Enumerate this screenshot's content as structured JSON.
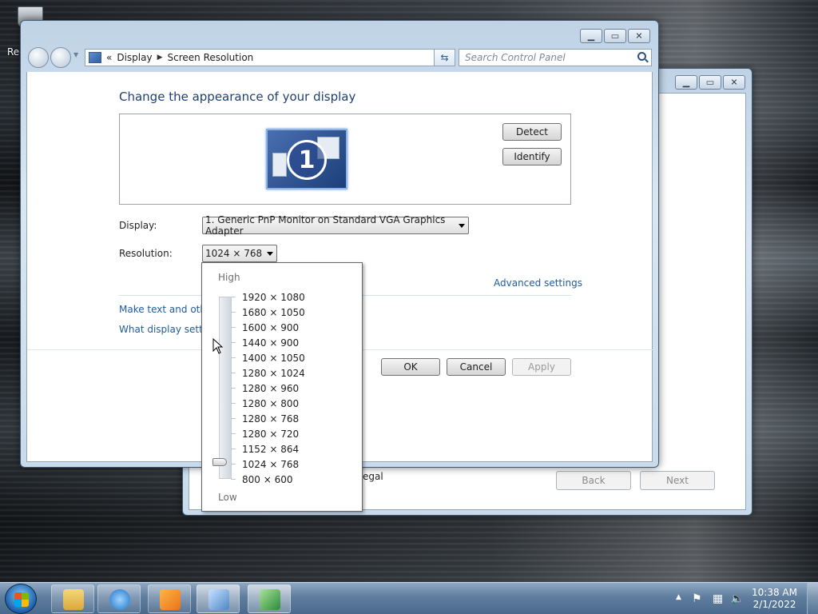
{
  "desktop": {
    "recycle_label": "Rec"
  },
  "back_window": {
    "partial_text": "egal",
    "back_label": "Back",
    "next_label": "Next"
  },
  "main_window": {
    "breadcrumb": {
      "chevrons": "«",
      "item1": "Display",
      "item2": "Screen Resolution"
    },
    "search_placeholder": "Search Control Panel",
    "heading": "Change the appearance of your display",
    "detect_label": "Detect",
    "identify_label": "Identify",
    "monitor_number": "1",
    "display_label": "Display:",
    "display_value": "1. Generic PnP Monitor on Standard VGA Graphics Adapter",
    "resolution_label": "Resolution:",
    "resolution_value": "1024 × 768",
    "advanced_link": "Advanced settings",
    "link1": "Make text and other",
    "link2": "What display setting",
    "ok_label": "OK",
    "cancel_label": "Cancel",
    "apply_label": "Apply"
  },
  "resolution_popup": {
    "high_label": "High",
    "low_label": "Low",
    "options": [
      "1920 × 1080",
      "1680 × 1050",
      "1600 × 900",
      "1440 × 900",
      "1400 × 1050",
      "1280 × 1024",
      "1280 × 960",
      "1280 × 800",
      "1280 × 768",
      "1280 × 720",
      "1152 × 864",
      "1024 × 768",
      "800 × 600"
    ],
    "selected": "1024 × 768"
  },
  "taskbar": {
    "time": "10:38 AM",
    "date": "2/1/2022",
    "items": [
      "file-explorer-icon",
      "internet-explorer-icon",
      "media-player-icon",
      "control-panel-icon",
      "installer-icon"
    ]
  }
}
